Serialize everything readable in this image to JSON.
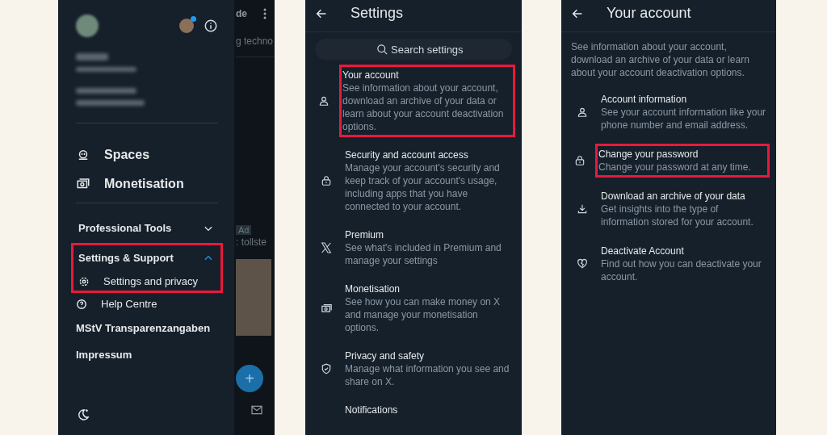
{
  "panels": [
    {
      "kind": "drawer",
      "nav_items": [
        {
          "label": "Spaces"
        },
        {
          "label": "Monetisation"
        }
      ],
      "sections": [
        {
          "label": "Professional Tools",
          "expanded": false,
          "highlighted": false
        },
        {
          "label": "Settings & Support",
          "expanded": true,
          "highlighted": true,
          "children": [
            {
              "label": "Settings and privacy"
            }
          ]
        }
      ],
      "after_items": [
        {
          "label": "Help Centre"
        },
        {
          "label": "MStV Transparenzangaben"
        },
        {
          "label": "Impressum"
        }
      ],
      "feed_behind": {
        "header_text": "de",
        "trend_text": "g techno",
        "ad_badge": "Ad",
        "ad_text": ": tollste",
        "fab_label": "+"
      }
    },
    {
      "kind": "list",
      "title": "Settings",
      "search": {
        "placeholder": "Search settings"
      },
      "items": [
        {
          "title": "Your account",
          "description": "See information about your account, download an archive of your data or learn about your account deactivation options.",
          "highlighted": true
        },
        {
          "title": "Security and account access",
          "description": "Manage your account's security and keep track of your account's usage, including apps that you have connected to your account.",
          "highlighted": false
        },
        {
          "title": "Premium",
          "description": "See what's included in Premium and manage your settings",
          "highlighted": false
        },
        {
          "title": "Monetisation",
          "description": "See how you can make money on X and manage your monetisation options.",
          "highlighted": false
        },
        {
          "title": "Privacy and safety",
          "description": "Manage what information you see and share on X.",
          "highlighted": false
        },
        {
          "title": "Notifications",
          "highlighted": false
        }
      ]
    },
    {
      "kind": "list",
      "title": "Your account",
      "intro": "See information about your account, download an archive of your data or learn about your account deactivation options.",
      "items": [
        {
          "title": "Account information",
          "description": "See your account information like your phone number and email address.",
          "highlighted": false
        },
        {
          "title": "Change your password",
          "description": "Change your password at any time.",
          "highlighted": true
        },
        {
          "title": "Download an archive of your data",
          "description": "Get insights into the type of information stored for your account.",
          "highlighted": false
        },
        {
          "title": "Deactivate Account",
          "description": "Find out how you can deactivate your account.",
          "highlighted": false
        }
      ]
    }
  ]
}
